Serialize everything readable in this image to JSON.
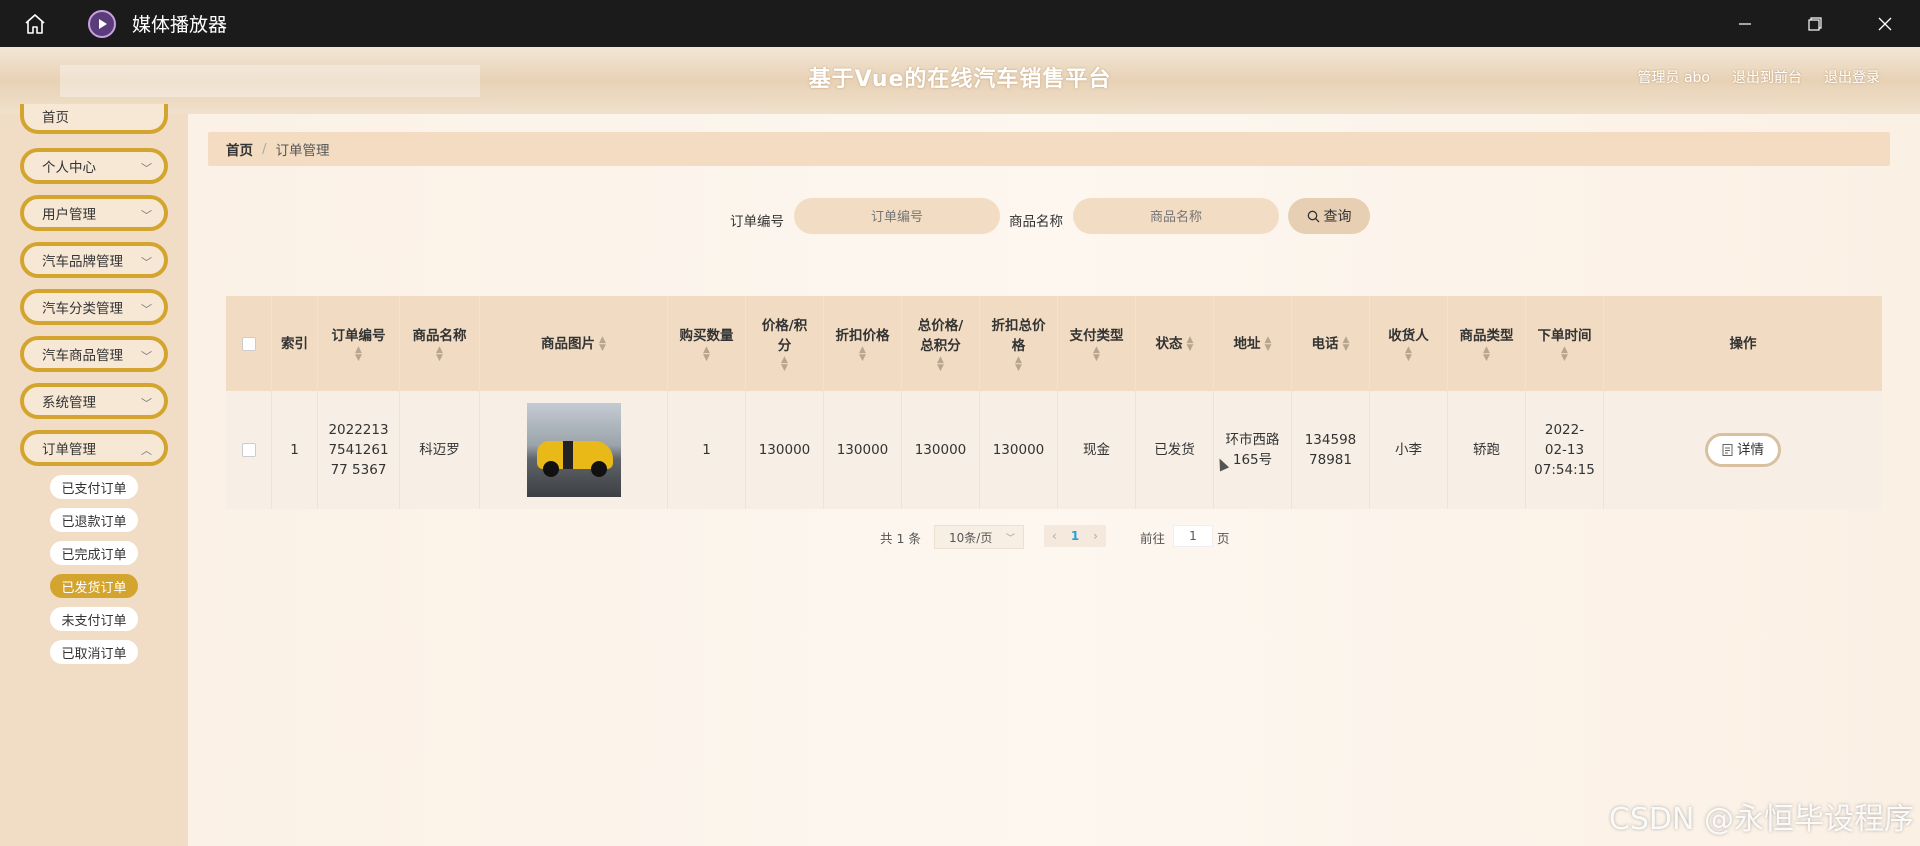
{
  "window": {
    "app_title": "媒体播放器",
    "icons": [
      "home-icon",
      "play-icon",
      "minimize-icon",
      "restore-icon",
      "close-icon"
    ]
  },
  "header": {
    "title": "基于Vue的在线汽车销售平台",
    "user": "管理员 abo",
    "back_front": "退出到前台",
    "logout": "退出登录"
  },
  "sidebar": {
    "top_item": "首页",
    "items": [
      {
        "label": "个人中心"
      },
      {
        "label": "用户管理"
      },
      {
        "label": "汽车品牌管理"
      },
      {
        "label": "汽车分类管理"
      },
      {
        "label": "汽车商品管理"
      },
      {
        "label": "系统管理"
      },
      {
        "label": "订单管理"
      }
    ],
    "sub_items": [
      {
        "label": "已支付订单"
      },
      {
        "label": "已退款订单"
      },
      {
        "label": "已完成订单"
      },
      {
        "label": "已发货订单"
      },
      {
        "label": "未支付订单"
      },
      {
        "label": "已取消订单"
      }
    ],
    "active_sub": "已发货订单"
  },
  "breadcrumb": {
    "home": "首页",
    "separator": "/",
    "current": "订单管理"
  },
  "search": {
    "order_label": "订单编号",
    "order_placeholder": "订单编号",
    "product_label": "商品名称",
    "product_placeholder": "商品名称",
    "button": "查询"
  },
  "table": {
    "headers": {
      "index": "索引",
      "order_no": "订单编号",
      "product_name": "商品名称",
      "product_image": "商品图片",
      "quantity": "购买数量",
      "price": "价格/积分",
      "discount_price": "折扣价格",
      "total": "总价格/总积分",
      "discount_total": "折扣总价格",
      "pay_type": "支付类型",
      "status": "状态",
      "address": "地址",
      "phone": "电话",
      "receiver": "收货人",
      "product_type": "商品类型",
      "order_time": "下单时间",
      "actions": "操作"
    },
    "rows": [
      {
        "index": "1",
        "order_no": "2022213754126177 5367",
        "product_name": "科迈罗",
        "quantity": "1",
        "price": "130000",
        "discount_price": "130000",
        "total": "130000",
        "discount_total": "130000",
        "pay_type": "现金",
        "status": "已发货",
        "address": "环市西路165号",
        "phone": "13459878981",
        "receiver": "小李",
        "product_type": "轿跑",
        "order_time": "2022-02-13 07:54:15",
        "action": "详情"
      }
    ]
  },
  "pagination": {
    "total": "共 1 条",
    "page_size": "10条/页",
    "current": "1",
    "goto": "前往",
    "goto_value": "1",
    "page_unit": "页"
  },
  "watermark": "CSDN @永恒毕设程序"
}
